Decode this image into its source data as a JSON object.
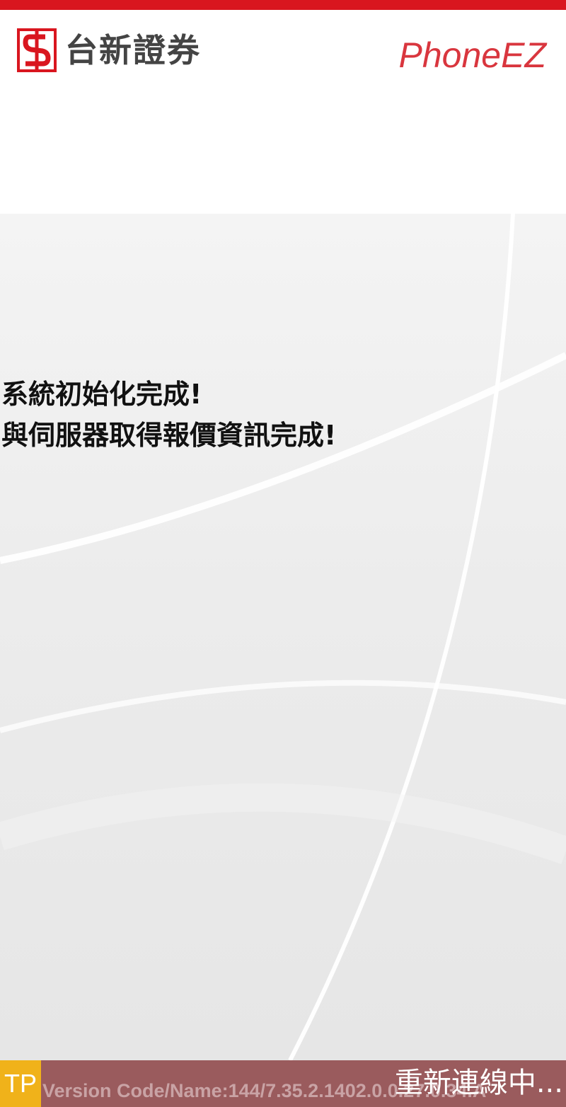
{
  "header": {
    "brand_name": "台新證券",
    "app_name": "PhoneEZ"
  },
  "colors": {
    "brand_red": "#d9161f",
    "badge_yellow": "#f0b21a",
    "status_bar": "#9a5b5d"
  },
  "icons": {
    "logo": "taishin-logo-icon"
  },
  "main": {
    "messages": [
      "系統初始化完成!",
      "與伺服器取得報價資訊完成!"
    ]
  },
  "status_bar": {
    "badge": "TP",
    "version": "Version Code/Name:144/7.35.2.1402.0.0.27.0.34.A",
    "reconnect": "重新連線中..."
  }
}
